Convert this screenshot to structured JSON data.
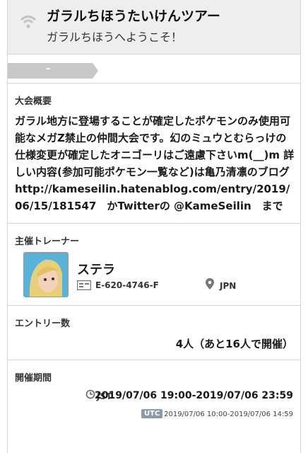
{
  "header": {
    "title": "ガラルちほうたいけんツアー",
    "subtitle": "ガラルちほうへようこそ！",
    "wifi_icon": "wifi-icon"
  },
  "ribbon": {
    "label": "–"
  },
  "overview": {
    "label": "大会概要",
    "text": "ガラル地方に登場することが確定したポケモンのみ使用可能なメガZ禁止の仲間大会です。幻のミュウとむらっけの仕様変更が確定したオニゴーリはご遠慮下さいm(__)m 詳しい内容(参加可能ポケモン一覧など)は亀乃清凛のブログ http://kameseilin.hatenablog.com/entry/2019/06/15/181547　かTwitterの @KameSeilin　まで"
  },
  "organizer": {
    "label": "主催トレーナー",
    "name": "ステラ",
    "trainer_id": "E-620-4746-F",
    "country": "JPN"
  },
  "entries": {
    "label": "エントリー数",
    "value": "4人（あと16人で開催）"
  },
  "period": {
    "label": "開催期間",
    "jst_label": "JST",
    "jst_range": "2019/07/06 19:00-2019/07/06 23:59",
    "utc_label": "UTC",
    "utc_range": "2019/07/06 10:00-2019/07/06 14:59"
  },
  "colors": {
    "header_bg": "#eeeeee",
    "ribbon": "#c8c8c8",
    "utc_badge": "#8a9aa6"
  }
}
